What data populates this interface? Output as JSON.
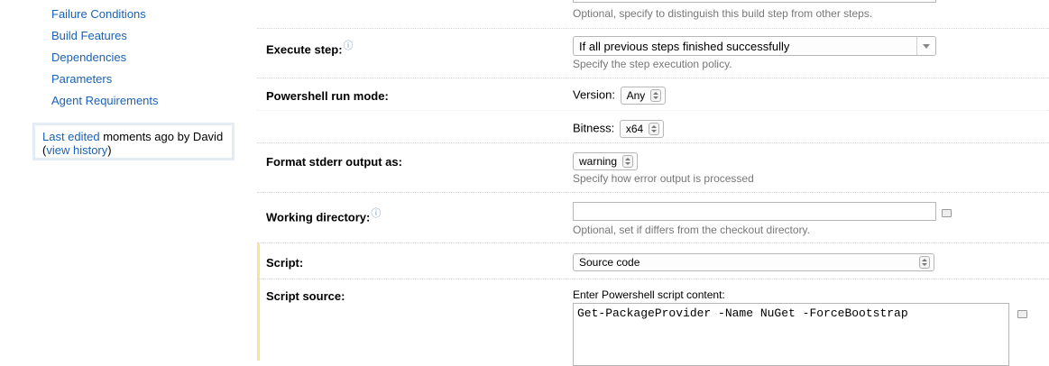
{
  "sidebar": {
    "nav_items": [
      {
        "label": "Failure Conditions"
      },
      {
        "label": "Build Features"
      },
      {
        "label": "Dependencies"
      },
      {
        "label": "Parameters"
      },
      {
        "label": "Agent Requirements"
      }
    ],
    "last_edited_link": "Last edited",
    "last_edited_text": " moments ago  by David",
    "view_history_open": "(",
    "view_history_link": "view history",
    "view_history_close": ")"
  },
  "form": {
    "step_name_note": "Optional, specify to distinguish this build step from other steps.",
    "execute_step": {
      "label": "Execute step:",
      "value": "If all previous steps finished successfully",
      "note": "Specify the step execution policy."
    },
    "powershell_mode": {
      "label": "Powershell run mode:",
      "version_label": "Version:",
      "version_value": "Any",
      "bitness_label": "Bitness:",
      "bitness_value": "x64"
    },
    "stderr": {
      "label": "Format stderr output as:",
      "value": "warning",
      "note": "Specify how error output is processed"
    },
    "working_dir": {
      "label": "Working directory:",
      "value": "",
      "note": "Optional, set if differs from the checkout directory."
    },
    "script": {
      "label": "Script:",
      "value": "Source code"
    },
    "script_source": {
      "label": "Script source:",
      "prompt": "Enter Powershell script content:",
      "content": "Get-PackageProvider -Name NuGet -ForceBootstrap"
    }
  },
  "colors": {
    "link": "#1a62b5",
    "highlight_bar": "#f5e49a",
    "sidebar_box_border": "#e3ecf5"
  },
  "icons": [
    "help-icon",
    "stepper-icon",
    "dropdown-arrow-icon",
    "expand-editor-icon"
  ]
}
